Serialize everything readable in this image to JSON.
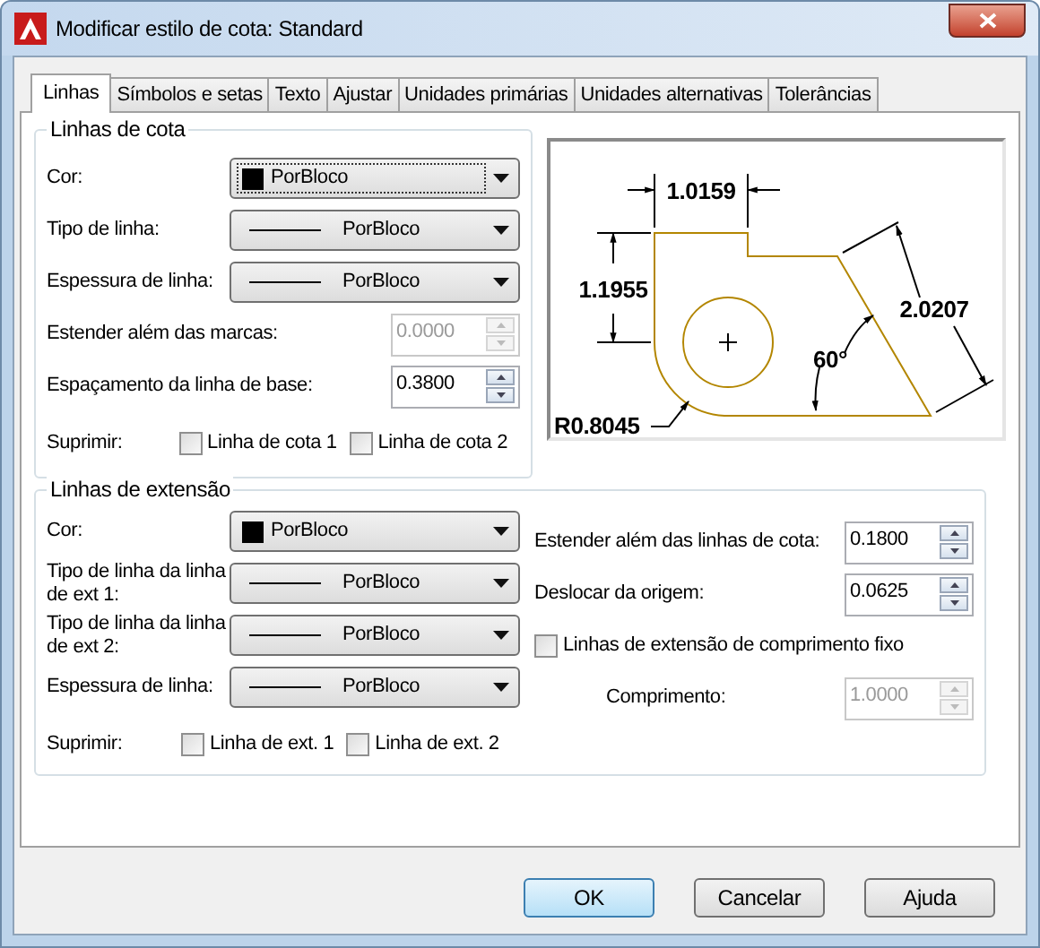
{
  "window": {
    "title": "Modificar estilo de cota: Standard"
  },
  "tabs": [
    {
      "label": "Linhas",
      "selected": true
    },
    {
      "label": "Símbolos e setas",
      "selected": false
    },
    {
      "label": "Texto",
      "selected": false
    },
    {
      "label": "Ajustar",
      "selected": false
    },
    {
      "label": "Unidades primárias",
      "selected": false
    },
    {
      "label": "Unidades alternativas",
      "selected": false
    },
    {
      "label": "Tolerâncias",
      "selected": false
    }
  ],
  "dimension_lines": {
    "title": "Linhas de cota",
    "rows": [
      {
        "kind": "color_dropdown",
        "label": "Cor:",
        "value": "PorBloco",
        "focused": true
      },
      {
        "kind": "line_dropdown",
        "label": "Tipo de linha:",
        "value": "PorBloco",
        "focused": false
      },
      {
        "kind": "line_dropdown",
        "label": "Espessura de linha:",
        "value": "PorBloco",
        "focused": false
      },
      {
        "kind": "spinner",
        "label": "Estender além das marcas:",
        "value": "0.0000",
        "disabled": true
      },
      {
        "kind": "spinner",
        "label": "Espaçamento da linha de base:",
        "value": "0.3800",
        "disabled": false
      },
      {
        "kind": "checkboxes",
        "label": "Suprimir:",
        "options": [
          {
            "label": "Linha de cota 1",
            "checked": false
          },
          {
            "label": "Linha de cota 2",
            "checked": false
          }
        ]
      }
    ]
  },
  "preview": {
    "labels": [
      "1.0159",
      "1.1955",
      "2.0207",
      "60°",
      "R0.8045"
    ]
  },
  "extension_lines": {
    "title": "Linhas de extensão",
    "rows": [
      {
        "kind": "color_dropdown",
        "label": "Cor:",
        "value": "PorBloco",
        "focused": false
      },
      {
        "kind": "line_dropdown",
        "label": "Tipo de linha da linha de ext 1:",
        "value": "PorBloco",
        "focused": false
      },
      {
        "kind": "line_dropdown",
        "label": "Tipo de linha da linha de ext 2:",
        "value": "PorBloco",
        "focused": false
      },
      {
        "kind": "line_dropdown",
        "label": "Espessura de linha:",
        "value": "PorBloco",
        "focused": false
      },
      {
        "kind": "checkboxes",
        "label": "Suprimir:",
        "options": [
          {
            "label": "Linha de ext. 1",
            "checked": false
          },
          {
            "label": "Linha de ext. 2",
            "checked": false
          }
        ]
      }
    ],
    "right_rows": [
      {
        "kind": "spinner",
        "label": "Estender além das linhas de cota:",
        "value": "0.1800",
        "disabled": false
      },
      {
        "kind": "spinner",
        "label": "Deslocar da origem:",
        "value": "0.0625",
        "disabled": false
      },
      {
        "kind": "checkbox",
        "label": "Linhas de extensão de comprimento fixo",
        "checked": false
      },
      {
        "kind": "spinner",
        "label": "Comprimento:",
        "value": "1.0000",
        "disabled": true
      }
    ]
  },
  "buttons": [
    {
      "label": "OK",
      "default": true
    },
    {
      "label": "Cancelar",
      "default": false
    },
    {
      "label": "Ajuda",
      "default": false
    }
  ]
}
